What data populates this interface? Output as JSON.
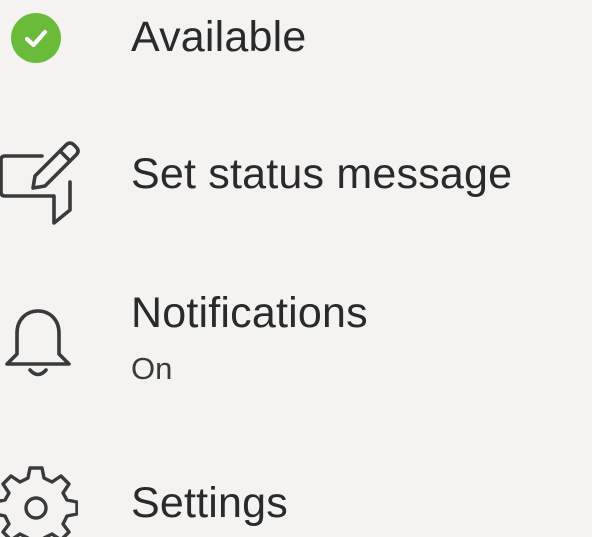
{
  "menu": {
    "items": [
      {
        "label": "Available",
        "icon": "check-circle-icon",
        "status_color": "#6bbb3a"
      },
      {
        "label": "Set status message",
        "icon": "edit-message-icon"
      },
      {
        "label": "Notifications",
        "sublabel": "On",
        "icon": "bell-icon"
      },
      {
        "label": "Settings",
        "icon": "gear-icon"
      }
    ]
  }
}
